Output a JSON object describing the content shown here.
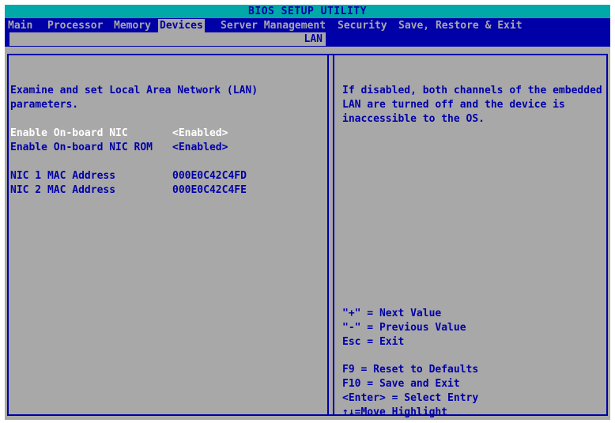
{
  "title": "BIOS SETUP UTILITY",
  "menu": {
    "items": [
      {
        "label": "Main",
        "active": false
      },
      {
        "label": "Processor",
        "active": false
      },
      {
        "label": "Memory",
        "active": false
      },
      {
        "label": "Devices",
        "active": true
      },
      {
        "label": "Server Management",
        "active": false
      },
      {
        "label": "Security",
        "active": false
      },
      {
        "label": "Save, Restore & Exit",
        "active": false
      }
    ],
    "submenu": "LAN"
  },
  "left": {
    "description_line1": "Examine and set Local Area Network (LAN)",
    "description_line2": "parameters.",
    "settings": [
      {
        "label": "Enable On-board NIC",
        "value": "<Enabled>"
      },
      {
        "label": "Enable On-board NIC ROM",
        "value": "<Enabled>"
      }
    ],
    "info": [
      {
        "label": "NIC 1 MAC Address",
        "value": "000E0C42C4FD"
      },
      {
        "label": "NIC 2 MAC Address",
        "value": "000E0C42C4FE"
      }
    ]
  },
  "right": {
    "help_line1": "If disabled, both channels of the embedded",
    "help_line2": "LAN are turned off and the device is",
    "help_line3": "inaccessible to the OS.",
    "keys": [
      "\"+\" = Next Value",
      "\"-\" = Previous Value",
      "Esc = Exit",
      "F9 = Reset to Defaults",
      "F10 = Save and Exit",
      "<Enter> = Select Entry",
      "↑↓=Move Highlight"
    ]
  },
  "colors": {
    "bios_blue": "#0000a8",
    "bios_gray": "#a8a8a8",
    "bios_cyan": "#00a8a8",
    "highlight": "#ffffff"
  }
}
